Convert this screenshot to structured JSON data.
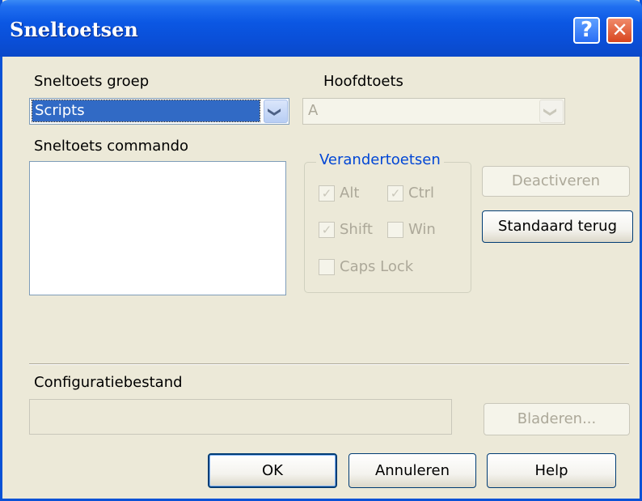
{
  "window": {
    "title": "Sneltoetsen",
    "help_glyph": "?",
    "close_glyph": "✕"
  },
  "shortcut_group": {
    "label": "Sneltoets groep",
    "selected": "Scripts"
  },
  "main_key": {
    "label": "Hoofdtoets",
    "selected": "A"
  },
  "command": {
    "label": "Sneltoets commando"
  },
  "modifiers": {
    "legend": "Verandertoetsen",
    "items": [
      {
        "label": "Alt",
        "checked": true
      },
      {
        "label": "Ctrl",
        "checked": true
      },
      {
        "label": "Shift",
        "checked": true
      },
      {
        "label": "Win",
        "checked": false
      },
      {
        "label": "Caps Lock",
        "checked": false
      }
    ]
  },
  "buttons": {
    "deactivate": "Deactiveren",
    "restore_default": "Standaard terug",
    "browse": "Bladeren...",
    "ok": "OK",
    "cancel": "Annuleren",
    "help": "Help"
  },
  "config_file": {
    "label": "Configuratiebestand",
    "value": ""
  },
  "icons": {
    "dropdown_arrow": "❯",
    "checkmark": "✓"
  }
}
